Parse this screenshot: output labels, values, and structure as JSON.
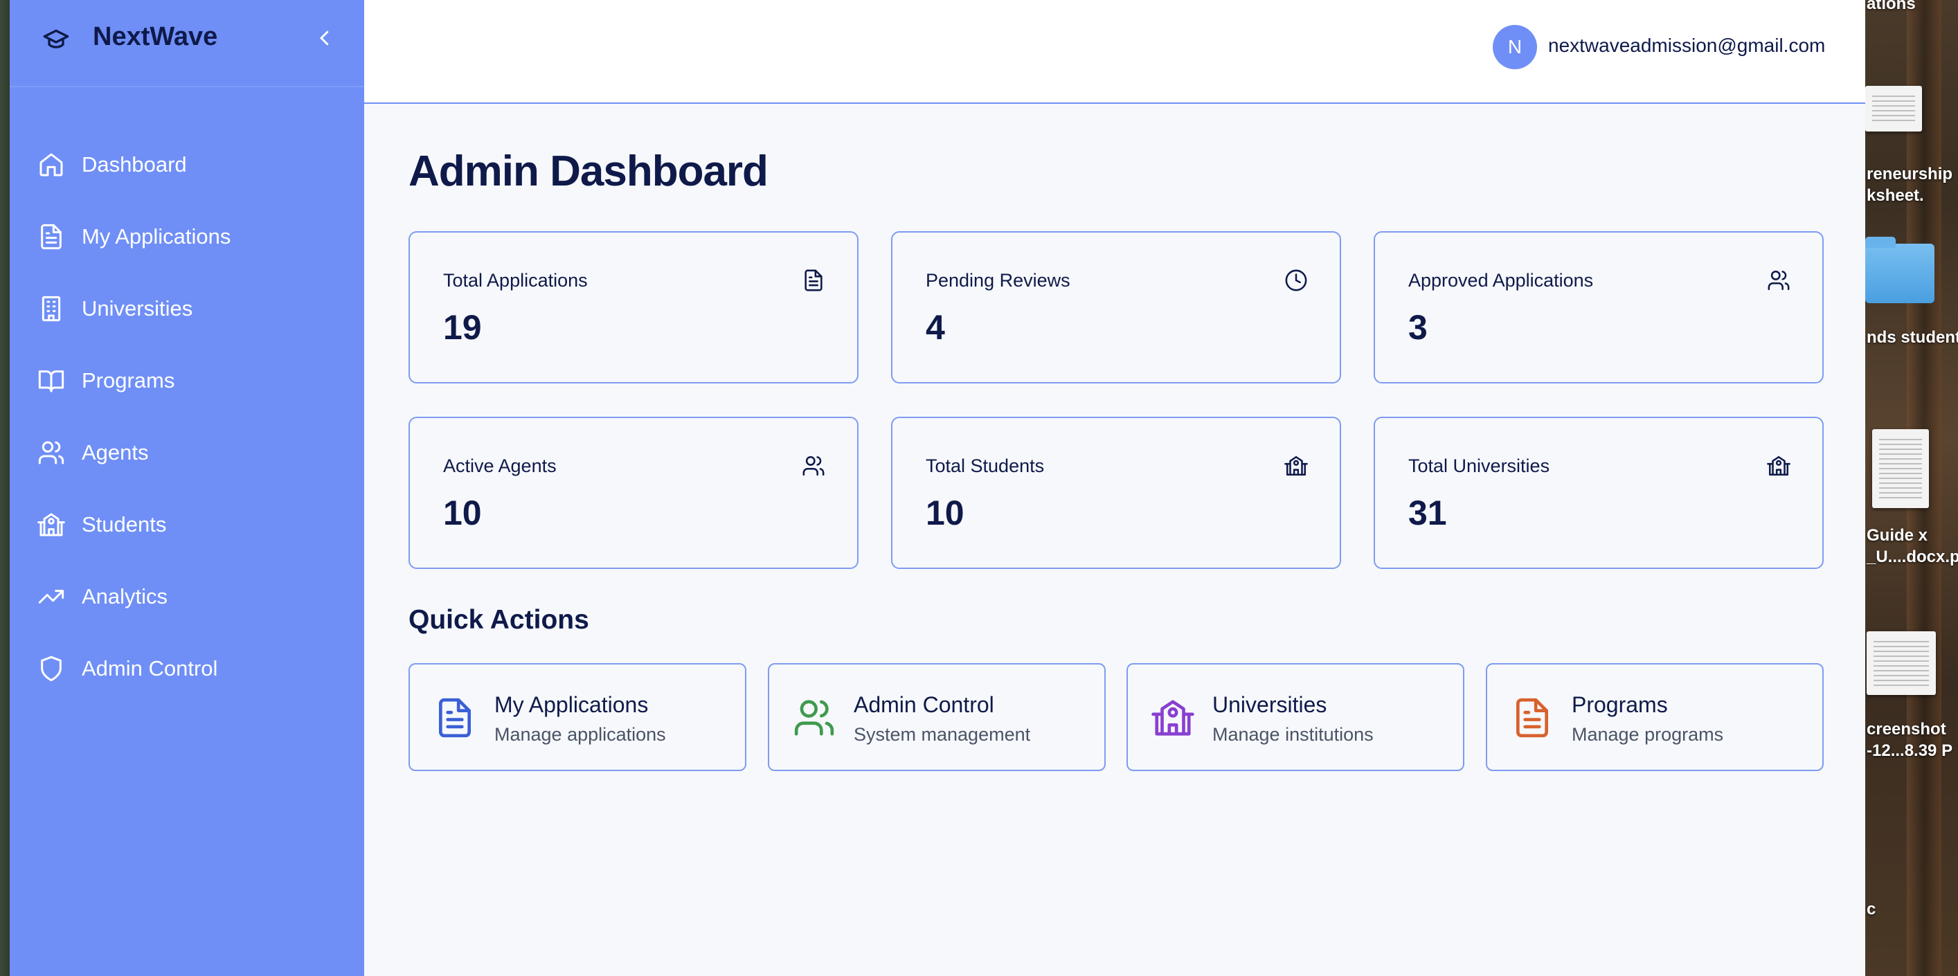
{
  "app": {
    "brand_name": "NextWave",
    "user_initial": "N",
    "user_email": "nextwaveadmission@gmail.com"
  },
  "sidebar": {
    "items": [
      {
        "label": "Dashboard",
        "icon": "home-icon"
      },
      {
        "label": "My Applications",
        "icon": "document-icon"
      },
      {
        "label": "Universities",
        "icon": "building-icon"
      },
      {
        "label": "Programs",
        "icon": "book-icon"
      },
      {
        "label": "Agents",
        "icon": "users-icon"
      },
      {
        "label": "Students",
        "icon": "school-icon"
      },
      {
        "label": "Analytics",
        "icon": "trending-up-icon"
      },
      {
        "label": "Admin Control",
        "icon": "shield-icon"
      }
    ]
  },
  "main": {
    "page_title": "Admin Dashboard",
    "stats": [
      {
        "label": "Total Applications",
        "value": "19",
        "icon": "document-icon"
      },
      {
        "label": "Pending Reviews",
        "value": "4",
        "icon": "clock-icon"
      },
      {
        "label": "Approved Applications",
        "value": "3",
        "icon": "users-icon"
      },
      {
        "label": "Active Agents",
        "value": "10",
        "icon": "users-icon"
      },
      {
        "label": "Total Students",
        "value": "10",
        "icon": "school-icon"
      },
      {
        "label": "Total Universities",
        "value": "31",
        "icon": "school-icon"
      }
    ],
    "quick_actions_title": "Quick Actions",
    "quick_actions": [
      {
        "title": "My Applications",
        "subtitle": "Manage applications",
        "icon": "document-icon",
        "color": "#3a5fd6"
      },
      {
        "title": "Admin Control",
        "subtitle": "System management",
        "icon": "users-icon",
        "color": "#3f9a4f"
      },
      {
        "title": "Universities",
        "subtitle": "Manage institutions",
        "icon": "school-icon",
        "color": "#8a3fd1"
      },
      {
        "title": "Programs",
        "subtitle": "Manage programs",
        "icon": "document-icon",
        "color": "#d8612c"
      }
    ]
  },
  "desktop": {
    "labels": [
      "ations",
      "reneurship",
      "ksheet.",
      "nds student",
      "Guide x",
      "_U....docx.p",
      "creenshot",
      "-12...8.39 P",
      "c"
    ]
  },
  "colors": {
    "sidebar": "#6f8ff6",
    "text_dark": "#0f1a4a",
    "card_border": "#7f9bf2",
    "background": "#f6f8fb"
  }
}
